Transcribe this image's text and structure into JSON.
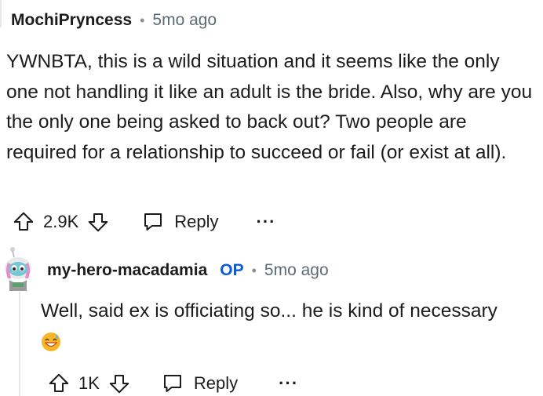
{
  "comment1": {
    "author": "MochiPryncess",
    "separator": "•",
    "time": "5mo ago",
    "body": "YWNBTA, this is a wild situation and it seems like the only one not handling it like an adult is the bride. Also, why are you the only one being asked to back out? Two people are required for a relationship to succeed or fail (or exist at all).",
    "votes": "2.9K",
    "reply_label": "Reply",
    "more_label": "···"
  },
  "comment2": {
    "author": "my-hero-macadamia",
    "op_badge": "OP",
    "separator": "•",
    "time": "5mo ago",
    "body": "Well, said ex is officiating so... he is kind of necessary",
    "emoji": "sweat-smile-emoji",
    "votes": "1K",
    "reply_label": "Reply",
    "more_label": "···"
  },
  "icons": {
    "upvote": "upvote-arrow-icon",
    "downvote": "downvote-arrow-icon",
    "reply": "speech-bubble-icon",
    "more": "more-options-icon"
  }
}
